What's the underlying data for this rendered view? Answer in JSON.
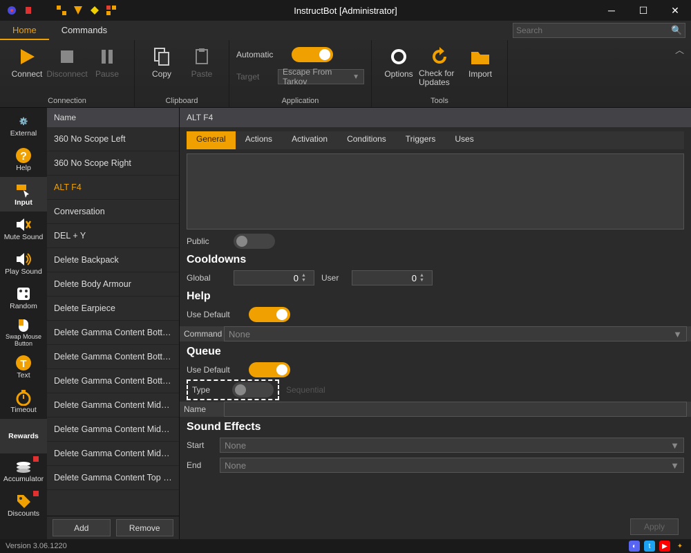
{
  "window": {
    "title": "InstructBot [Administrator]"
  },
  "tabs": {
    "home": "Home",
    "commands": "Commands"
  },
  "search": {
    "placeholder": "Search"
  },
  "ribbon": {
    "connection": {
      "label": "Connection",
      "connect": "Connect",
      "disconnect": "Disconnect",
      "pause": "Pause"
    },
    "clipboard": {
      "label": "Clipboard",
      "copy": "Copy",
      "paste": "Paste"
    },
    "application": {
      "label": "Application",
      "automatic": "Automatic",
      "target": "Target",
      "target_value": "Escape From Tarkov"
    },
    "tools": {
      "label": "Tools",
      "options": "Options",
      "check_updates": "Check for Updates",
      "import": "Import"
    }
  },
  "sidebar": {
    "items": [
      {
        "label": "External"
      },
      {
        "label": "Help"
      },
      {
        "label": "Input"
      },
      {
        "label": "Mute Sound"
      },
      {
        "label": "Play Sound"
      },
      {
        "label": "Random"
      },
      {
        "label": "Swap Mouse Button"
      },
      {
        "label": "Text"
      },
      {
        "label": "Timeout"
      },
      {
        "label": "Rewards"
      },
      {
        "label": "Accumulator"
      },
      {
        "label": "Discounts"
      }
    ]
  },
  "list": {
    "header": "Name",
    "items": [
      "360 No Scope Left",
      "360 No Scope Right",
      "ALT F4",
      "Conversation",
      "DEL + Y",
      "Delete Backpack",
      "Delete Body Armour",
      "Delete Earpiece",
      "Delete Gamma Content Bottom ...",
      "Delete Gamma Content Bottom ...",
      "Delete Gamma Content Bottom ...",
      "Delete Gamma Content Middle ...",
      "Delete Gamma Content Middle L...",
      "Delete Gamma Content Middle ...",
      "Delete Gamma Content Top Ce..."
    ],
    "selected_index": 2,
    "add": "Add",
    "remove": "Remove"
  },
  "details": {
    "title": "ALT F4",
    "subtabs": [
      "General",
      "Actions",
      "Activation",
      "Conditions",
      "Triggers",
      "Uses"
    ],
    "public_label": "Public",
    "cooldowns": {
      "heading": "Cooldowns",
      "global_label": "Global",
      "global_value": "0",
      "user_label": "User",
      "user_value": "0"
    },
    "help": {
      "heading": "Help",
      "use_default": "Use Default",
      "command_label": "Command",
      "command_value": "None"
    },
    "queue": {
      "heading": "Queue",
      "use_default": "Use Default",
      "type_label": "Type",
      "type_hint": "Sequential",
      "name_label": "Name"
    },
    "sound": {
      "heading": "Sound Effects",
      "start_label": "Start",
      "start_value": "None",
      "end_label": "End",
      "end_value": "None"
    },
    "apply": "Apply"
  },
  "status": {
    "version": "Version 3.06.1220"
  }
}
